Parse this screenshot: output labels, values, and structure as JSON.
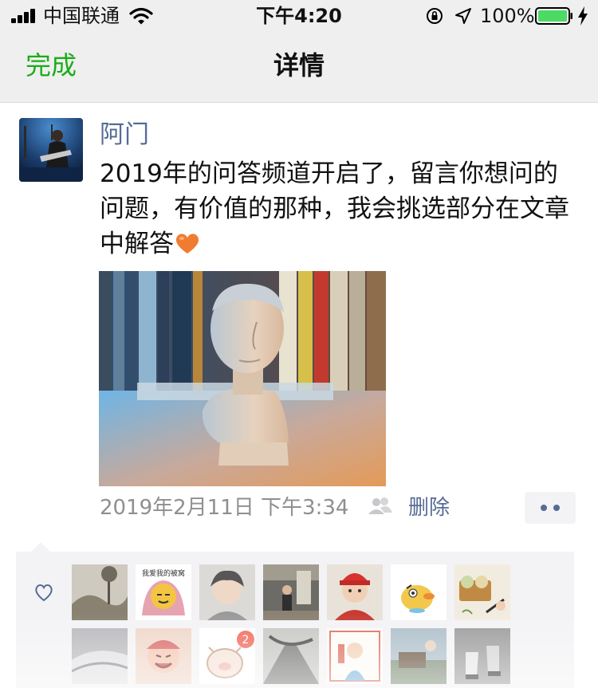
{
  "status_bar": {
    "carrier": "中国联通",
    "time": "下午4:20",
    "battery": "100%",
    "icons": [
      "signal-icon",
      "wifi-icon",
      "orientation-lock-icon",
      "location-icon",
      "battery-icon",
      "charging-icon"
    ]
  },
  "nav": {
    "done_label": "完成",
    "title": "详情"
  },
  "post": {
    "author": "阿门",
    "text": "2019年的问答频道开启了，留言你想问的问题，有价值的那种，我会挑选部分在文章中解答",
    "date": "2019年2月11日 下午3:34",
    "delete_label": "删除"
  },
  "likes": {
    "sticker_text": "我爱我的被窝",
    "badge_count": "2"
  },
  "colors": {
    "accent_green": "#1aad19",
    "link_blue": "#576b95",
    "meta_gray": "#8f8f8f",
    "panel_gray": "#f3f3f5"
  }
}
